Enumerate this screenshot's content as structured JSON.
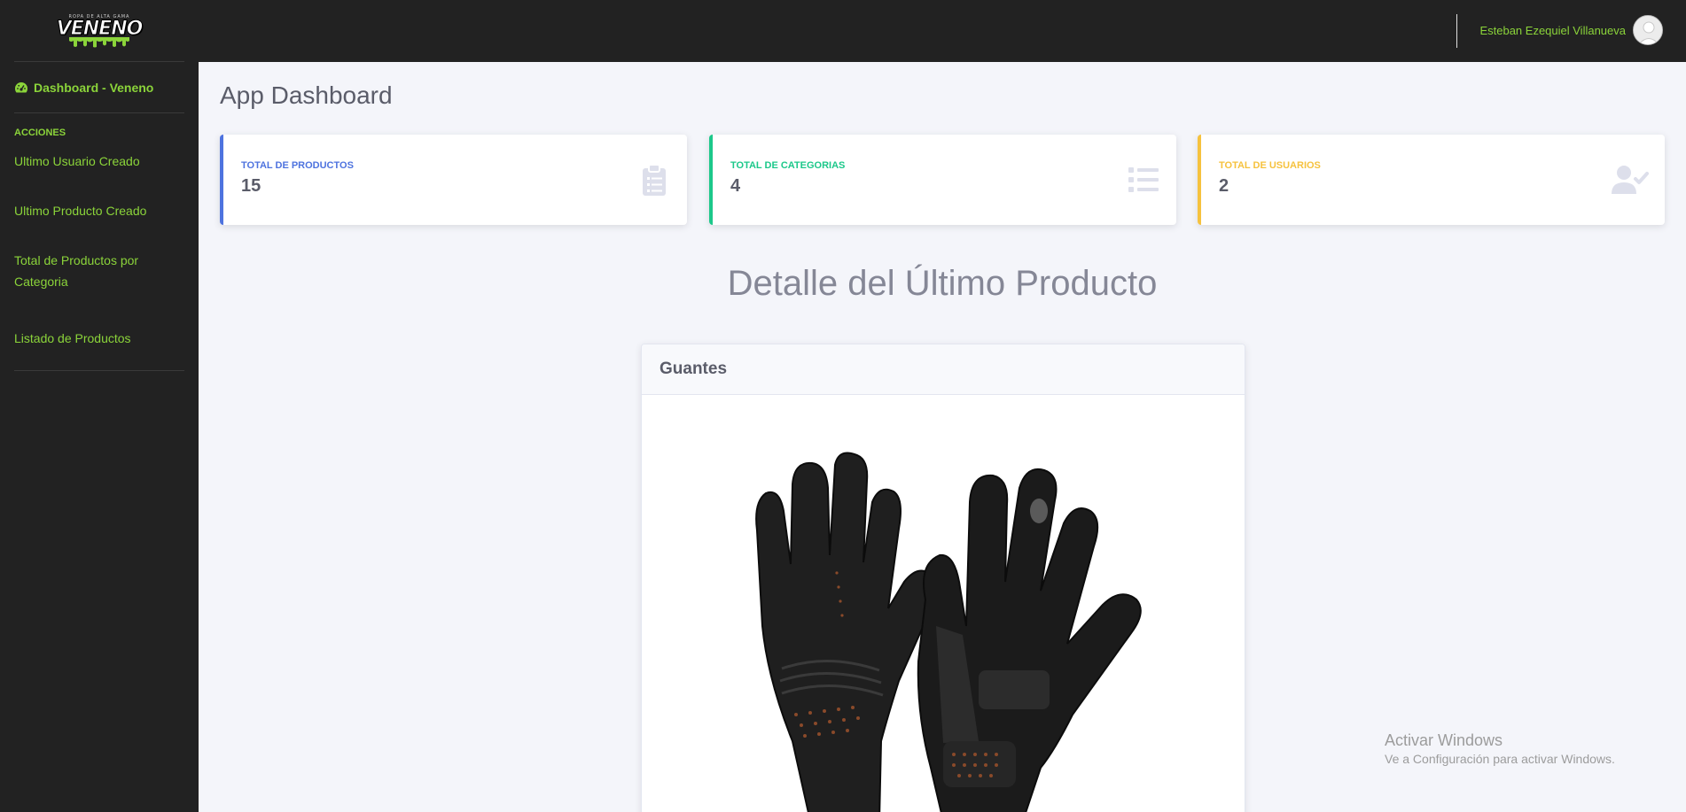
{
  "brand": {
    "logo_tagline": "ROPA DE ALTA GAMA",
    "logo_word": "VENENO"
  },
  "sidebar": {
    "top_link": "Dashboard - Veneno",
    "heading": "ACCIONES",
    "items": [
      {
        "label": "Ultimo Usuario Creado"
      },
      {
        "label": "Ultimo Producto Creado"
      },
      {
        "label": "Total de Productos por Categoria"
      },
      {
        "label": "Listado de Productos"
      }
    ]
  },
  "topbar": {
    "user_name": "Esteban Ezequiel Villanueva"
  },
  "main": {
    "title": "App Dashboard",
    "cards": [
      {
        "label": "TOTAL DE PRODUCTOS",
        "value": "15",
        "icon": "clipboard-list-icon",
        "color": "#4e73df"
      },
      {
        "label": "TOTAL DE CATEGORIAS",
        "value": "4",
        "icon": "list-icon",
        "color": "#1cc88a"
      },
      {
        "label": "TOTAL DE USUARIOS",
        "value": "2",
        "icon": "user-check-icon",
        "color": "#f6c23e"
      }
    ],
    "section_title": "Detalle del Último Producto",
    "product": {
      "name": "Guantes",
      "image": "black-gloves-image"
    }
  },
  "watermark": {
    "line1": "Activar Windows",
    "line2": "Ve a Configuración para activar Windows."
  },
  "colors": {
    "accent": "#8bd43a",
    "sidebar_bg": "#222222",
    "page_bg": "#f4f5fa"
  }
}
